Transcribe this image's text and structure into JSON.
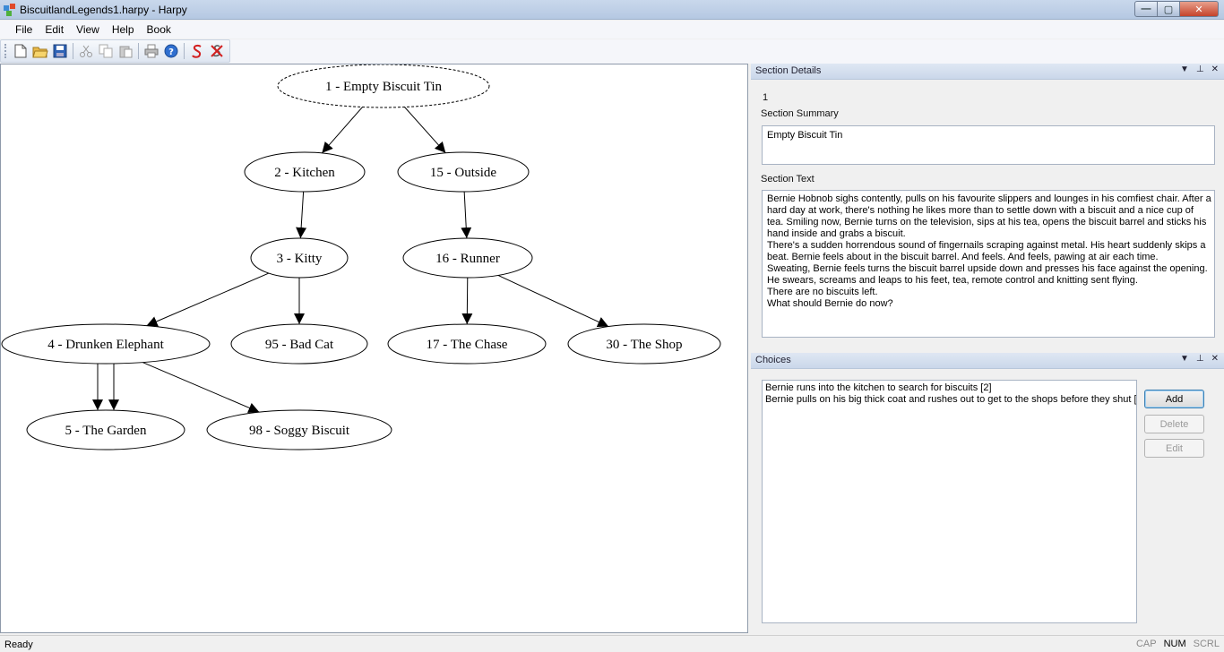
{
  "window": {
    "title": "BiscuitlandLegends1.harpy - Harpy",
    "controls": {
      "minimize": "—",
      "maximize": "▢",
      "close": "✕"
    }
  },
  "menu": [
    "File",
    "Edit",
    "View",
    "Help",
    "Book"
  ],
  "toolbar": {
    "icons": [
      "new-file-icon",
      "open-folder-icon",
      "save-icon",
      "cut-icon",
      "copy-icon",
      "paste-icon",
      "print-icon",
      "help-icon",
      "s-icon",
      "delete-icon"
    ]
  },
  "graph": {
    "nodes": [
      {
        "id": "n1",
        "label": "1 - Empty Biscuit Tin",
        "dashed": true
      },
      {
        "id": "n2",
        "label": "2 - Kitchen"
      },
      {
        "id": "n15",
        "label": "15 - Outside"
      },
      {
        "id": "n3",
        "label": "3 - Kitty"
      },
      {
        "id": "n16",
        "label": "16 - Runner"
      },
      {
        "id": "n4",
        "label": "4 - Drunken Elephant"
      },
      {
        "id": "n95",
        "label": "95 - Bad Cat"
      },
      {
        "id": "n17",
        "label": "17 - The Chase"
      },
      {
        "id": "n30",
        "label": "30 - The Shop"
      },
      {
        "id": "n5",
        "label": "5 - The Garden"
      },
      {
        "id": "n98",
        "label": "98 - Soggy Biscuit"
      }
    ],
    "edges": [
      [
        "n1",
        "n2"
      ],
      [
        "n1",
        "n15"
      ],
      [
        "n2",
        "n3"
      ],
      [
        "n15",
        "n16"
      ],
      [
        "n3",
        "n4"
      ],
      [
        "n3",
        "n95"
      ],
      [
        "n16",
        "n17"
      ],
      [
        "n16",
        "n30"
      ],
      [
        "n4",
        "n5"
      ],
      [
        "n4",
        "n5"
      ],
      [
        "n4",
        "n98"
      ]
    ]
  },
  "section_details": {
    "header": "Section Details",
    "section_number": "1",
    "summary_label": "Section Summary",
    "summary": "Empty Biscuit Tin",
    "text_label": "Section Text",
    "text_lines": [
      "Bernie Hobnob sighs contently, pulls on his favourite slippers and lounges in his comfiest chair.  After a",
      "hard day at work, there's nothing he likes more than to settle down with a biscuit and a nice cup of",
      "tea.  Smiling now, Bernie turns on the television, sips at his tea, opens the biscuit barrel and sticks his",
      "hand inside and grabs a biscuit.",
      "There's a sudden horrendous sound of fingernails scraping against metal.  His heart suddenly skips a",
      "beat.  Bernie feels about in the biscuit barrel.  And feels.  And feels, pawing at air each time.",
      "Sweating, Bernie feels turns the biscuit barrel upside down and presses his face against the opening.",
      "He swears, screams and leaps to his feet, tea, remote control and knitting sent flying.",
      "There are no biscuits left.",
      "What should Bernie do now?"
    ]
  },
  "choices": {
    "header": "Choices",
    "items": [
      "Bernie runs into the kitchen to search for biscuits [2]",
      "Bernie pulls on his big thick coat and rushes out to get to the shops before they shut ["
    ],
    "add_label": "Add",
    "delete_label": "Delete",
    "edit_label": "Edit"
  },
  "panel_controls": {
    "dropdown": "▼",
    "pin": "⊥",
    "close": "✕"
  },
  "status": {
    "text": "Ready",
    "indicators": [
      {
        "label": "CAP",
        "on": false
      },
      {
        "label": "NUM",
        "on": true
      },
      {
        "label": "SCRL",
        "on": false
      }
    ]
  }
}
